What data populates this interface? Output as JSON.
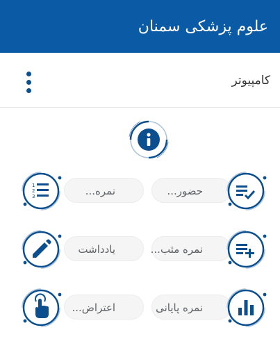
{
  "app": {
    "title": "علوم پزشکی سمنان"
  },
  "course": {
    "name": "کامپیوتر"
  },
  "menu": {
    "attendance": "حضور...",
    "grade": "نمره...",
    "positive_grade": "نمره مثب...",
    "note": "یادداشت",
    "final_grade": "نمره پایانی",
    "objection": "اعتراض..."
  },
  "icons": {
    "more": "more-vertical-icon",
    "info": "info-icon",
    "attendance": "playlist-check-icon",
    "grade": "ordered-list-icon",
    "positive_grade": "playlist-add-icon",
    "note": "pencil-icon",
    "final_grade": "bar-chart-icon",
    "objection": "touch-hand-icon"
  },
  "colors": {
    "header": "#0b5aa6",
    "icon": "#0b4f8f"
  }
}
